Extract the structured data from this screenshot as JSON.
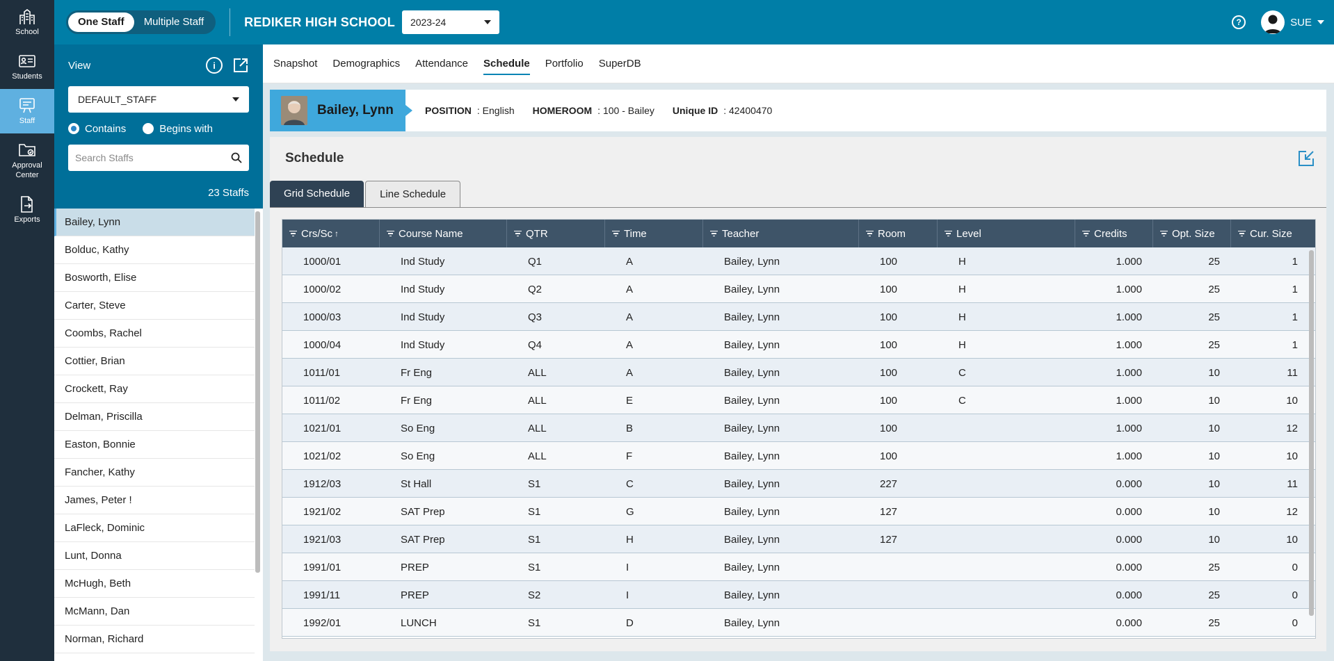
{
  "rail": {
    "items": [
      {
        "label": "School",
        "icon": "school-icon"
      },
      {
        "label": "Students",
        "icon": "students-icon"
      },
      {
        "label": "Staff",
        "icon": "staff-icon"
      },
      {
        "label": "Approval Center",
        "icon": "approval-folder-icon"
      },
      {
        "label": "Exports",
        "icon": "export-file-icon"
      }
    ]
  },
  "topbar": {
    "toggle_one": "One Staff",
    "toggle_multiple": "Multiple Staff",
    "school_name": "REDIKER HIGH SCHOOL",
    "year": "2023-24",
    "help": "?",
    "user": "SUE"
  },
  "panel": {
    "view_label": "View",
    "info": "i",
    "view_value": "DEFAULT_STAFF",
    "radio_contains": "Contains",
    "radio_begins": "Begins with",
    "search_placeholder": "Search Staffs",
    "count": "23 Staffs",
    "staff": [
      "Bailey, Lynn",
      "Bolduc, Kathy",
      "Bosworth, Elise",
      "Carter, Steve",
      "Coombs, Rachel",
      "Cottier, Brian",
      "Crockett, Ray",
      "Delman, Priscilla",
      "Easton, Bonnie",
      "Fancher, Kathy",
      "James, Peter !",
      "LaFleck, Dominic",
      "Lunt, Donna",
      "McHugh, Beth",
      "McMann, Dan",
      "Norman, Richard"
    ]
  },
  "tabs": [
    "Snapshot",
    "Demographics",
    "Attendance",
    "Schedule",
    "Portfolio",
    "SuperDB"
  ],
  "profile": {
    "name": "Bailey, Lynn",
    "position_key": "POSITION",
    "position_val": ": English",
    "homeroom_key": "HOMEROOM",
    "homeroom_val": ": 100 - Bailey",
    "uid_key": "Unique ID",
    "uid_val": ": 42400470"
  },
  "schedule": {
    "title": "Schedule",
    "tab_grid": "Grid Schedule",
    "tab_line": "Line Schedule",
    "columns": [
      "Crs/Sc",
      "Course Name",
      "QTR",
      "Time",
      "Teacher",
      "Room",
      "Level",
      "Credits",
      "Opt. Size",
      "Cur. Size"
    ],
    "sort_arrow": "↑",
    "rows": [
      [
        "1000/01",
        "Ind Study",
        "Q1",
        "A",
        "Bailey, Lynn",
        "100",
        "H",
        "1.000",
        "25",
        "1"
      ],
      [
        "1000/02",
        "Ind Study",
        "Q2",
        "A",
        "Bailey, Lynn",
        "100",
        "H",
        "1.000",
        "25",
        "1"
      ],
      [
        "1000/03",
        "Ind Study",
        "Q3",
        "A",
        "Bailey, Lynn",
        "100",
        "H",
        "1.000",
        "25",
        "1"
      ],
      [
        "1000/04",
        "Ind Study",
        "Q4",
        "A",
        "Bailey, Lynn",
        "100",
        "H",
        "1.000",
        "25",
        "1"
      ],
      [
        "1011/01",
        "Fr Eng",
        "ALL",
        "A",
        "Bailey, Lynn",
        "100",
        "C",
        "1.000",
        "10",
        "11"
      ],
      [
        "1011/02",
        "Fr Eng",
        "ALL",
        "E",
        "Bailey, Lynn",
        "100",
        "C",
        "1.000",
        "10",
        "10"
      ],
      [
        "1021/01",
        "So Eng",
        "ALL",
        "B",
        "Bailey, Lynn",
        "100",
        "",
        "1.000",
        "10",
        "12"
      ],
      [
        "1021/02",
        "So Eng",
        "ALL",
        "F",
        "Bailey, Lynn",
        "100",
        "",
        "1.000",
        "10",
        "10"
      ],
      [
        "1912/03",
        "St Hall",
        "S1",
        "C",
        "Bailey, Lynn",
        "227",
        "",
        "0.000",
        "10",
        "11"
      ],
      [
        "1921/02",
        "SAT Prep",
        "S1",
        "G",
        "Bailey, Lynn",
        "127",
        "",
        "0.000",
        "10",
        "12"
      ],
      [
        "1921/03",
        "SAT Prep",
        "S1",
        "H",
        "Bailey, Lynn",
        "127",
        "",
        "0.000",
        "10",
        "10"
      ],
      [
        "1991/01",
        "PREP",
        "S1",
        "I",
        "Bailey, Lynn",
        "",
        "",
        "0.000",
        "25",
        "0"
      ],
      [
        "1991/11",
        "PREP",
        "S2",
        "I",
        "Bailey, Lynn",
        "",
        "",
        "0.000",
        "25",
        "0"
      ],
      [
        "1992/01",
        "LUNCH",
        "S1",
        "D",
        "Bailey, Lynn",
        "",
        "",
        "0.000",
        "25",
        "0"
      ]
    ]
  }
}
